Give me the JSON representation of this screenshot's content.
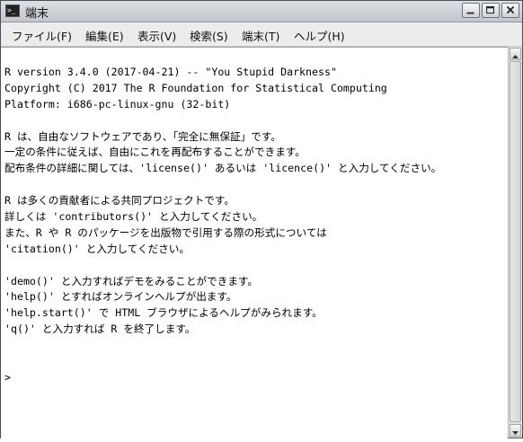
{
  "window": {
    "title": "端末"
  },
  "icons": {
    "app": "terminal-icon",
    "minimize": "minimize-icon",
    "maximize": "maximize-icon",
    "close": "close-icon",
    "scroll_up": "arrow-up-icon",
    "scroll_down": "arrow-down-icon"
  },
  "menu": {
    "items": [
      {
        "label": "ファイル(F)"
      },
      {
        "label": "編集(E)"
      },
      {
        "label": "表示(V)"
      },
      {
        "label": "検索(S)"
      },
      {
        "label": "端末(T)"
      },
      {
        "label": "ヘルプ(H)"
      }
    ]
  },
  "console": {
    "lines": [
      "R version 3.4.0 (2017-04-21) -- \"You Stupid Darkness\"",
      "Copyright (C) 2017 The R Foundation for Statistical Computing",
      "Platform: i686-pc-linux-gnu (32-bit)",
      "",
      "R は、自由なソフトウェアであり、「完全に無保証」です。",
      "一定の条件に従えば、自由にこれを再配布することができます。",
      "配布条件の詳細に関しては、'license()' あるいは 'licence()' と入力してください。",
      "",
      "R は多くの貢献者による共同プロジェクトです。",
      "詳しくは 'contributors()' と入力してください。",
      "また、R や R のパッケージを出版物で引用する際の形式については",
      "'citation()' と入力してください。",
      "",
      "'demo()' と入力すればデモをみることができます。",
      "'help()' とすればオンラインヘルプが出ます。",
      "'help.start()' で HTML ブラウザによるヘルプがみられます。",
      "'q()' と入力すれば R を終了します。",
      "",
      "",
      ">"
    ]
  }
}
